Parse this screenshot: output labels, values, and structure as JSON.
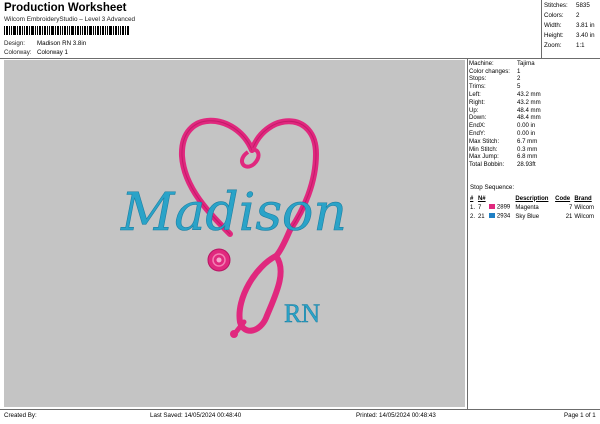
{
  "header": {
    "title": "Production Worksheet",
    "subtitle": "Wilcom EmbroideryStudio – Level 3 Advanced",
    "design_label": "Design:",
    "design_value": "Madison RN 3.8in",
    "colorway_label": "Colorway:",
    "colorway_value": "Colorway 1"
  },
  "summary": {
    "stitches_label": "Stitches:",
    "stitches_value": "5835",
    "colors_label": "Colors:",
    "colors_value": "2",
    "width_label": "Width:",
    "width_value": "3.81 in",
    "height_label": "Height:",
    "height_value": "3.40 in",
    "zoom_label": "Zoom:",
    "zoom_value": "1:1"
  },
  "design_preview": {
    "name_text": "Madison",
    "suffix_text": "RN",
    "colors": {
      "background": "#c4c4c4",
      "magenta": "#e0287e",
      "sky_blue": "#2aa3c8"
    }
  },
  "machine_info": [
    {
      "label": "Machine:",
      "value": "Tajima"
    },
    {
      "label": "Color changes:",
      "value": "1"
    },
    {
      "label": "Stops:",
      "value": "2"
    },
    {
      "label": "Trims:",
      "value": "5"
    },
    {
      "label": "Left:",
      "value": "43.2 mm"
    },
    {
      "label": "Right:",
      "value": "43.2 mm"
    },
    {
      "label": "Up:",
      "value": "48.4 mm"
    },
    {
      "label": "Down:",
      "value": "48.4 mm"
    },
    {
      "label": "EndX:",
      "value": "0.00 in"
    },
    {
      "label": "EndY:",
      "value": "0.00 in"
    },
    {
      "label": "Max Stitch:",
      "value": "6.7 mm"
    },
    {
      "label": "Min Stitch:",
      "value": "0.3 mm"
    },
    {
      "label": "Max Jump:",
      "value": "6.8 mm"
    },
    {
      "label": "Total Bobbin:",
      "value": "28.93ft"
    }
  ],
  "stop_sequence": {
    "title": "Stop Sequence:",
    "headers": [
      "#",
      "N#",
      "",
      "Description",
      "Code",
      "Brand"
    ],
    "rows": [
      {
        "num": "1.",
        "needle": "7",
        "color": "#e0287e",
        "code_num": "2899",
        "desc": "Magenta",
        "code": "7",
        "brand": "Wilcom"
      },
      {
        "num": "2.",
        "needle": "21",
        "color": "#1f7fc4",
        "code_num": "2934",
        "desc": "Sky Blue",
        "code": "21",
        "brand": "Wilcom"
      }
    ]
  },
  "footer": {
    "created_by": "Created By:",
    "last_saved": "Last Saved: 14/05/2024 00:48:40",
    "printed": "Printed: 14/05/2024 00:48:43",
    "page": "Page 1 of 1"
  }
}
